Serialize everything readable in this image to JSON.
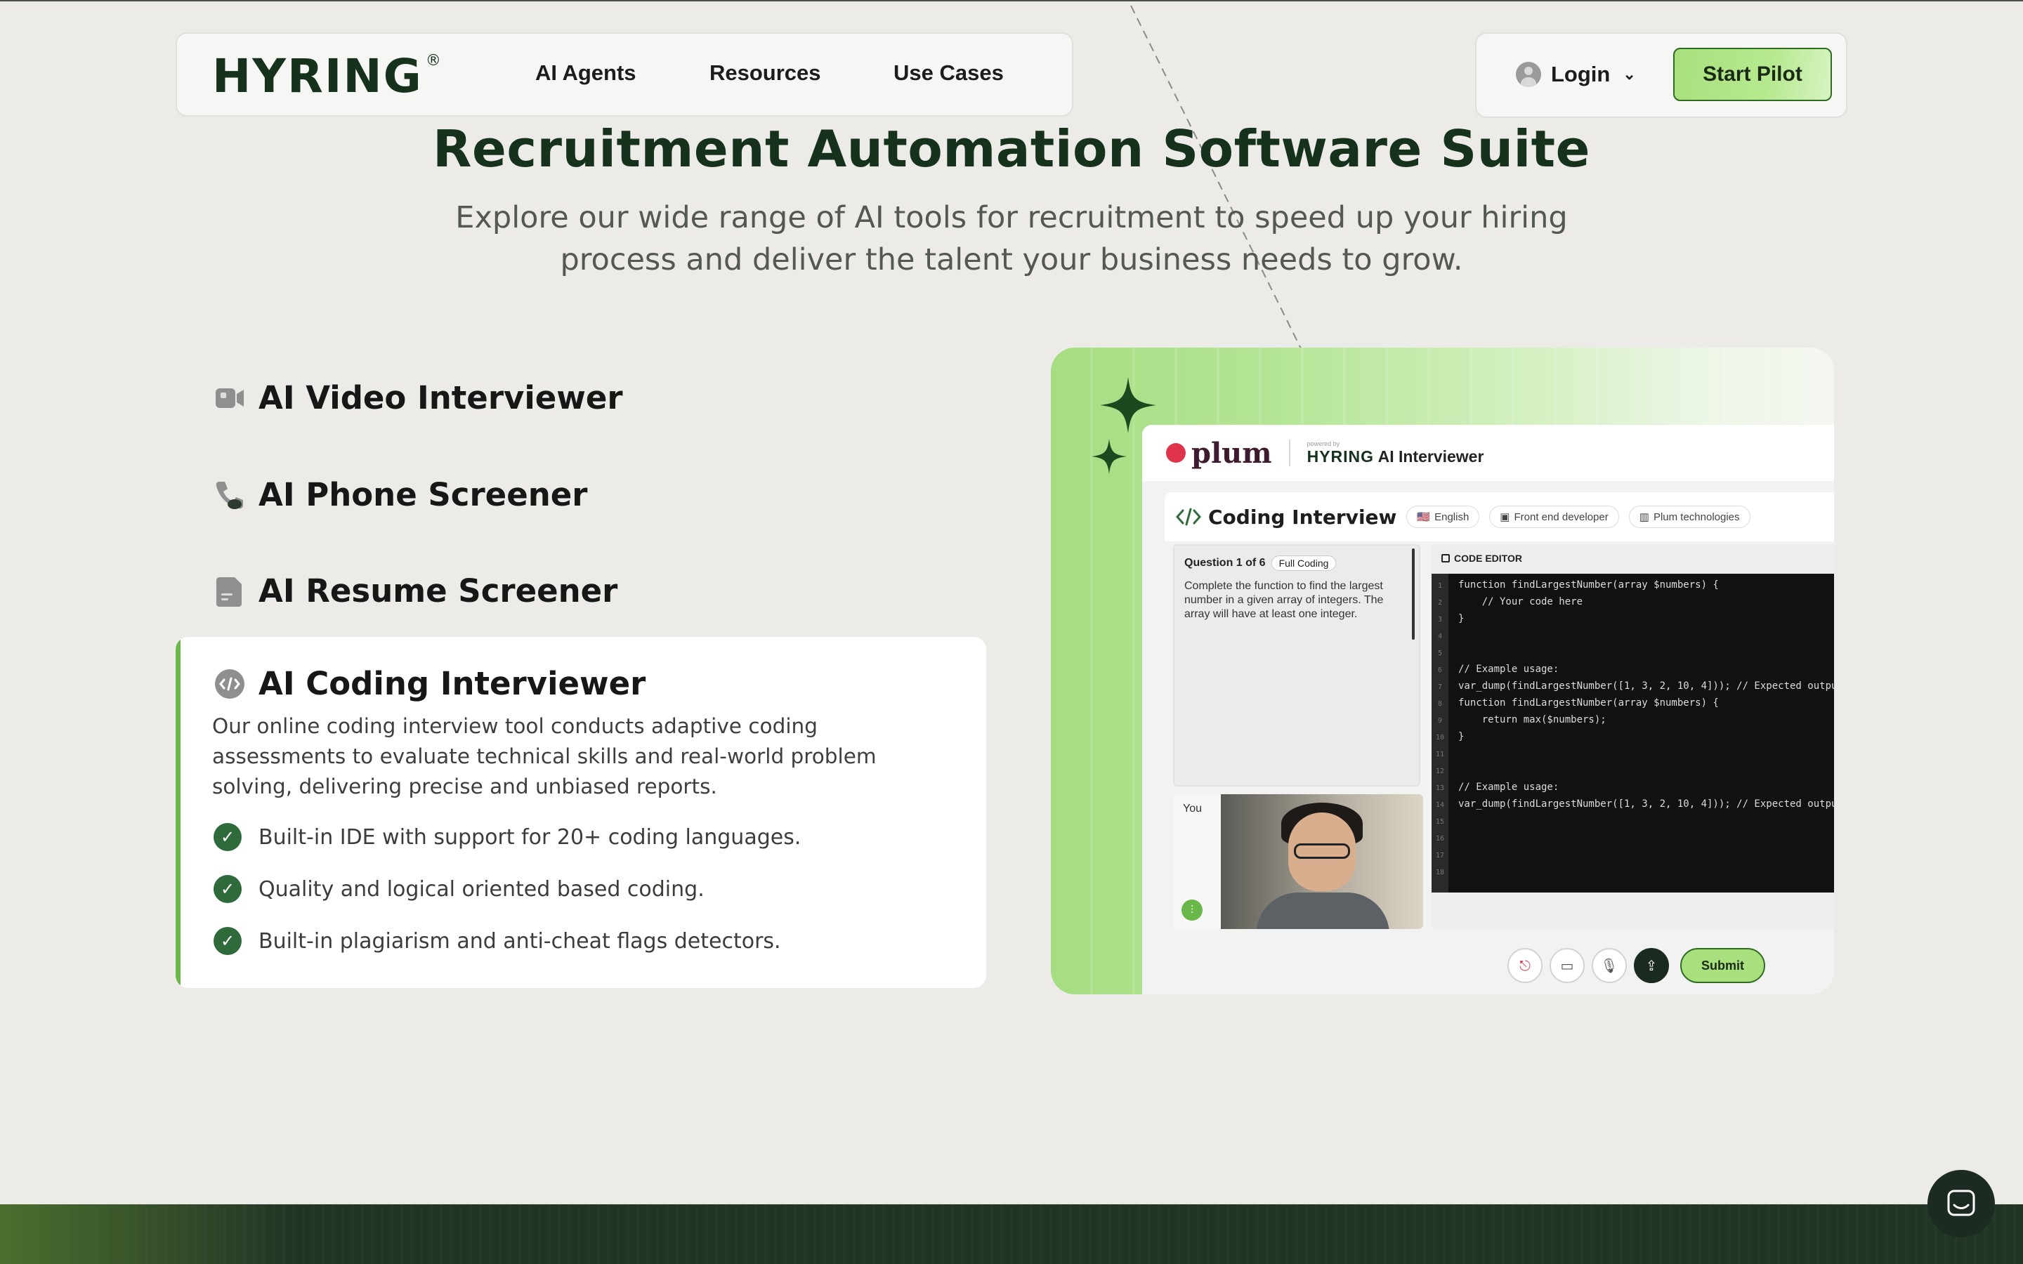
{
  "nav": {
    "logo": "HYRING",
    "logo_mark": "®",
    "links": [
      "AI Agents",
      "Resources",
      "Use Cases"
    ],
    "login_label": "Login",
    "cta_label": "Start Pilot"
  },
  "hero": {
    "title": "Recruitment Automation Software Suite",
    "subtitle": "Explore our wide range of AI tools for recruitment to speed up your hiring process and deliver the talent your business needs to grow."
  },
  "features": [
    {
      "title": "AI Video Interviewer",
      "icon": "video-camera-icon"
    },
    {
      "title": "AI Phone Screener",
      "icon": "phone-icon"
    },
    {
      "title": "AI Resume Screener",
      "icon": "document-icon"
    },
    {
      "title": "AI Coding Interviewer",
      "icon": "code-icon"
    }
  ],
  "active_feature": {
    "description": "Our online coding interview tool conducts adaptive coding assessments to evaluate technical skills and real-world problem solving, delivering precise and unbiased reports.",
    "bullets": [
      "Built-in IDE with support for 20+ coding languages.",
      "Quality and logical oriented based coding.",
      "Built-in plagiarism and anti-cheat flags detectors."
    ]
  },
  "preview": {
    "brand": "plum",
    "powered_by": "powered by",
    "product_brand": "HYRING",
    "product_name": "AI Interviewer",
    "page_title": "Coding Interview",
    "chips": [
      "English",
      "Front end developer",
      "Plum technologies"
    ],
    "question_counter": "Question 1 of 6",
    "question_tag": "Full Coding",
    "question_text": "Complete the function to find the largest number in a given array of integers. The array will have at least one integer.",
    "video_label": "You",
    "editor_label": "CODE EDITOR",
    "code_lines": [
      "function findLargestNumber(array $numbers) {",
      "    // Your code here",
      "}",
      "",
      "",
      "// Example usage:",
      "var_dump(findLargestNumber([1, 3, 2, 10, 4])); // Expected outpu",
      "function findLargestNumber(array $numbers) {",
      "    return max($numbers);",
      "}",
      "",
      "",
      "// Example usage:",
      "var_dump(findLargestNumber([1, 3, 2, 10, 4])); // Expected outpu",
      "",
      "",
      "",
      ""
    ],
    "submit_label": "Submit"
  },
  "colors": {
    "brand_dark": "#16321c",
    "accent_green": "#a8e07d",
    "check_green": "#2f6b3a",
    "active_bar": "#6ab84a"
  }
}
